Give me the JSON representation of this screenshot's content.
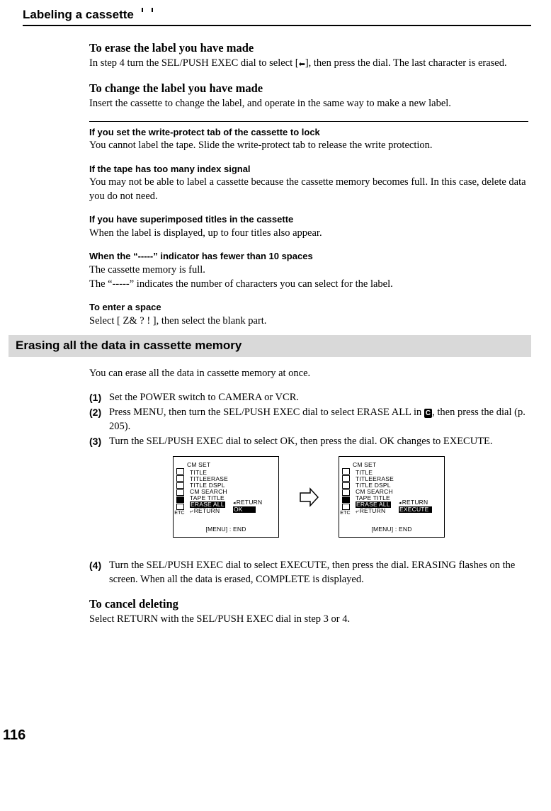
{
  "page_title": "Labeling a cassette",
  "sections": {
    "erase_label": {
      "heading": "To erase the label you have made",
      "body": "In step 4 turn the SEL/PUSH EXEC dial to select [←], then press the dial. The last character is erased."
    },
    "change_label": {
      "heading": "To change the label you have made",
      "body": "Insert the cassette to change the label, and operate in the same way to make a new label."
    },
    "write_protect": {
      "heading": "If you set the write-protect tab of the cassette to lock",
      "body": "You cannot label the tape. Slide the write-protect tab to release the write protection."
    },
    "index_signal": {
      "heading": "If the tape has too many index signal",
      "body": "You may not be able to label a cassette because the cassette memory becomes full. In this case, delete data you do not need."
    },
    "superimposed": {
      "heading": "If you have superimposed titles in the cassette",
      "body": "When the label is displayed, up to four titles also appear."
    },
    "indicator": {
      "heading": "When the “-----” indicator has fewer than 10 spaces",
      "body1": "The cassette memory is full.",
      "body2": "The “-----” indicates the number of characters you can select for the label."
    },
    "enter_space": {
      "heading": "To enter a space",
      "body": "Select [ Z&   ? ! ], then select the blank part."
    },
    "erase_all": {
      "bar": "Erasing all the data in cassette memory",
      "intro": "You can erase all the data in cassette memory at once.",
      "steps": {
        "n1": "(1)",
        "s1": "Set the POWER switch to CAMERA or VCR.",
        "n2": "(2)",
        "s2a": "Press MENU, then turn the SEL/PUSH EXEC dial to select ERASE ALL in ",
        "s2b": ", then press the dial (p. 205).",
        "n3": "(3)",
        "s3": "Turn the SEL/PUSH EXEC dial to select OK, then press the dial. OK changes to EXECUTE.",
        "n4": "(4)",
        "s4": "Turn the SEL/PUSH EXEC dial to select EXECUTE, then press the dial. ERASING flashes on the screen. When all the data is erased, COMPLETE is displayed."
      }
    },
    "cancel": {
      "heading": "To cancel deleting",
      "body": "Select RETURN with the SEL/PUSH EXEC dial in step 3 or 4."
    }
  },
  "screens": {
    "header": "CM  SET",
    "menu": [
      "TITLE",
      "TITLEERASE",
      "TITLE  DSPL",
      "CM  SEARCH",
      "TAPE  TITLE"
    ],
    "highlight": "ERASE  ALL",
    "return": "RETURN",
    "right_return": "RETURN",
    "right_ok": "OK",
    "right_execute": "EXECUTE",
    "footer": "[MENU] : END"
  },
  "page_number": "116"
}
